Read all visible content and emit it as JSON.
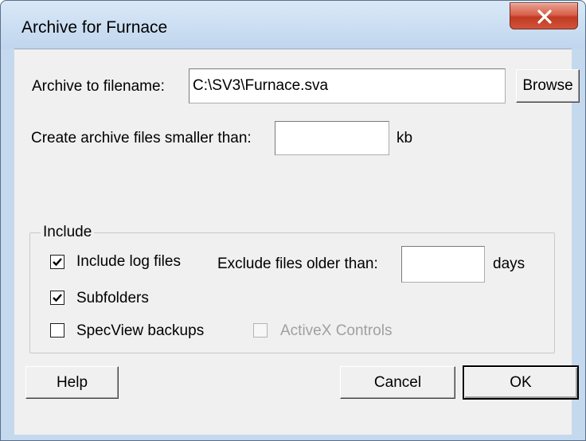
{
  "window": {
    "title": "Archive for Furnace"
  },
  "archive": {
    "label": "Archive to filename:",
    "value": "C:\\SV3\\Furnace.sva",
    "browse_label": "Browse"
  },
  "size_limit": {
    "label": "Create archive files smaller than:",
    "value": "",
    "unit": "kb"
  },
  "include": {
    "legend": "Include",
    "log_files": {
      "label": "Include log files",
      "checked": true
    },
    "exclude_label": "Exclude files older than:",
    "exclude_value": "",
    "exclude_unit": "days",
    "subfolders": {
      "label": "Subfolders",
      "checked": true
    },
    "specview_backups": {
      "label": "SpecView backups",
      "checked": false
    },
    "activex": {
      "label": "ActiveX Controls",
      "checked": false,
      "enabled": false
    }
  },
  "buttons": {
    "help": "Help",
    "cancel": "Cancel",
    "ok": "OK"
  },
  "colors": {
    "close_button": "#c8452d",
    "frame": "#c5d9ee",
    "client": "#f0f0f0"
  },
  "icons": {
    "close": "close-icon",
    "check": "checkmark-icon"
  }
}
